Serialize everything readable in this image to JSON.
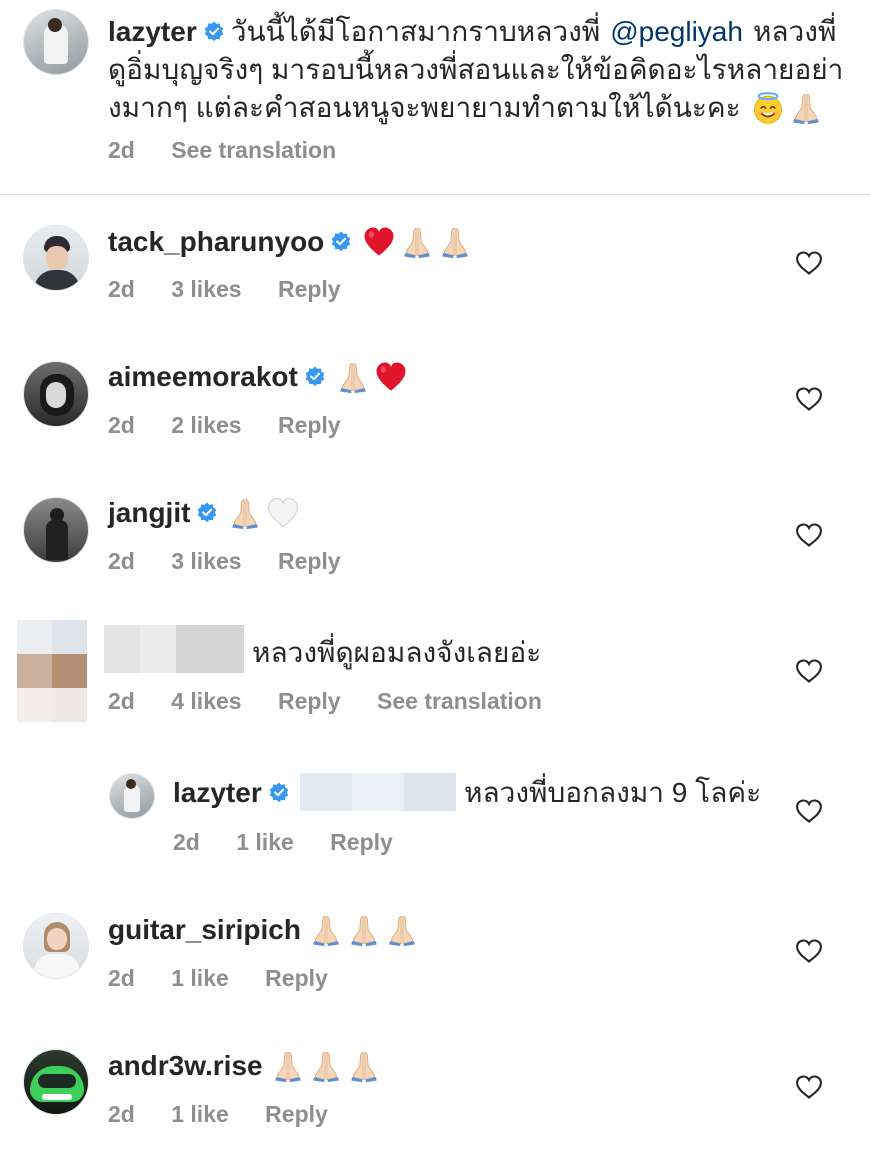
{
  "caption": {
    "username": "lazyter",
    "line1_text": "วันนี้ได้มีโอกาสมากราบหลวงพี่",
    "mention": "@pegliyah",
    "line1_tail": "หลวงพี่",
    "line2": "ดูอิ่มบุญจริงๆ มารอบนี้หลวงพี่สอนและให้ข้อคิดอะไรหลายอย่า",
    "line3": "งมากๆ แต่ละคำสอนหนูจะพยายามทำตามให้ได้นะคะ",
    "time": "2d",
    "see_translation": "See translation"
  },
  "comments": [
    {
      "username": "tack_pharunyoo",
      "time": "2d",
      "likes": "3 likes",
      "reply": "Reply"
    },
    {
      "username": "aimeemorakot",
      "time": "2d",
      "likes": "2 likes",
      "reply": "Reply"
    },
    {
      "username": "jangjit",
      "time": "2d",
      "likes": "3 likes",
      "reply": "Reply"
    },
    {
      "text": "หลวงพี่ดูผอมลงจังเลยอ่ะ",
      "time": "2d",
      "likes": "4 likes",
      "reply": "Reply",
      "see_translation": "See translation"
    },
    {
      "username": "guitar_siripich",
      "time": "2d",
      "likes": "1 like",
      "reply": "Reply"
    },
    {
      "username": "andr3w.rise",
      "time": "2d",
      "likes": "1 like",
      "reply": "Reply"
    }
  ],
  "reply_comment": {
    "username": "lazyter",
    "text": "หลวงพี่บอกลงมา 9 โลค่ะ",
    "time": "2d",
    "likes": "1 like",
    "reply": "Reply"
  },
  "icons": {
    "verified": "verified-badge-icon",
    "like": "heart-outline-icon",
    "emojis": [
      "red-heart",
      "folded-hands",
      "white-heart",
      "smiling-face-with-halo"
    ]
  },
  "colors": {
    "verified": "#3897f0",
    "mention": "#00376b",
    "meta": "#8e8e8e",
    "text": "#262626",
    "red_heart": "#e0142b"
  }
}
